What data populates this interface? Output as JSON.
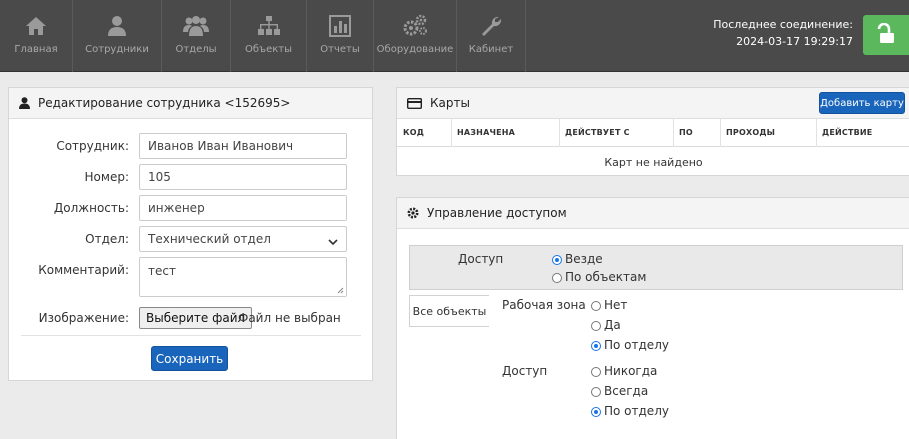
{
  "nav": {
    "items": [
      {
        "label": "Главная",
        "icon": "home-icon"
      },
      {
        "label": "Сотрудники",
        "icon": "user-icon"
      },
      {
        "label": "Отделы",
        "icon": "users-icon"
      },
      {
        "label": "Объекты",
        "icon": "sitemap-icon"
      },
      {
        "label": "Отчеты",
        "icon": "bar-chart-icon"
      },
      {
        "label": "Оборудование",
        "icon": "gears-icon"
      },
      {
        "label": "Кабинет",
        "icon": "wrench-icon"
      }
    ],
    "connection_label": "Последнее соединение:",
    "connection_time": "2024-03-17 19:29:17",
    "lock_icon": "unlock-icon"
  },
  "employee": {
    "title": "Редактирование сотрудника <152695>",
    "fields": {
      "name_label": "Сотрудник:",
      "name_value": "Иванов Иван Иванович",
      "number_label": "Номер:",
      "number_value": "105",
      "position_label": "Должность:",
      "position_value": "инженер",
      "department_label": "Отдел:",
      "department_value": "Технический отдел",
      "comment_label": "Комментарий:",
      "comment_value": "тест",
      "image_label": "Изображение:",
      "file_button": "Выберите файл",
      "file_status": "Файл не выбран"
    },
    "save_label": "Сохранить"
  },
  "cards": {
    "title": "Карты",
    "add_label": "Добавить карту",
    "columns": [
      "КОД",
      "НАЗНАЧЕНА",
      "ДЕЙСТВУЕТ С",
      "ПО",
      "ПРОХОДЫ",
      "ДЕЙСТВИЕ"
    ],
    "empty_text": "Карт не найдено"
  },
  "access": {
    "title": "Управление доступом",
    "access_label": "Доступ",
    "access_options": [
      {
        "label": "Везде",
        "selected": true
      },
      {
        "label": "По объектам",
        "selected": false
      }
    ],
    "all_objects_label": "Все объекты",
    "work_zone_label": "Рабочая зона",
    "work_zone_options": [
      {
        "label": "Нет",
        "selected": false
      },
      {
        "label": "Да",
        "selected": false
      },
      {
        "label": "По отделу",
        "selected": true
      }
    ],
    "access2_label": "Доступ",
    "access2_options": [
      {
        "label": "Никогда",
        "selected": false
      },
      {
        "label": "Всегда",
        "selected": false
      },
      {
        "label": "По отделу",
        "selected": true
      }
    ]
  },
  "colors": {
    "topbar": "#4a4a4a",
    "primary": "#1a65bc",
    "success": "#5cb85c",
    "radio_selected": "#1a73e8"
  }
}
